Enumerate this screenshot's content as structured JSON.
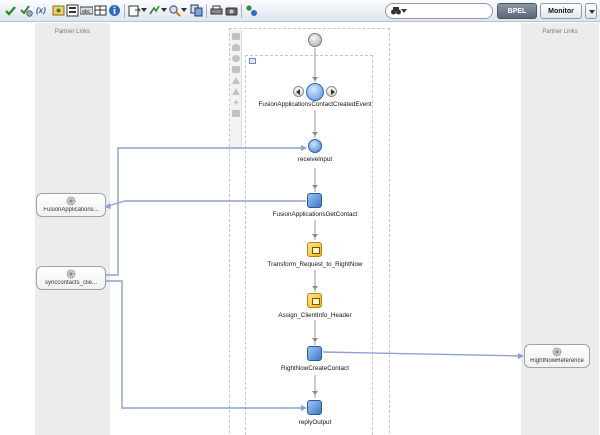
{
  "toolbar": {
    "search_value": "",
    "bpel_label": "BPEL",
    "monitor_label": "Monitor"
  },
  "lanes": {
    "left_title": "Partner Links",
    "right_title": "Partner Links"
  },
  "activities": {
    "pick_label": "FusionApplicationsContactCreatedEvent",
    "receive_label": "receiveInput",
    "get_contact_label": "FusionApplicationsGetContact",
    "transform_label": "Transform_Request_to_RightNow",
    "assign_label": "Assign_ClientInfo_Header",
    "create_contact_label": "RightNowCreateContact",
    "reply_label": "replyOutput"
  },
  "partner_links": {
    "fusion": "FusionApplications...",
    "sync": "synccontacts_clie...",
    "rightnow": "RightNowReference"
  },
  "colors": {
    "wire": "#8f9fd8",
    "flow_line": "#9a9a9a",
    "lane_bg": "#ececec",
    "accent_blue": "#3d7fcc"
  }
}
